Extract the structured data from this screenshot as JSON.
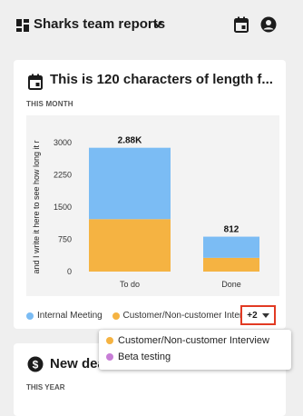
{
  "header": {
    "team_title": "Sharks team reports"
  },
  "card1": {
    "title": "This is 120 characters of length f...",
    "subtitle": "THIS MONTH"
  },
  "chart_data": {
    "type": "bar",
    "stacked": true,
    "categories": [
      "To do",
      "Done"
    ],
    "ylabel": "and I write it here to see how long it r",
    "ylim": [
      0,
      3000
    ],
    "yticks": [
      0,
      750,
      1500,
      2250,
      3000
    ],
    "series": [
      {
        "name": "Customer/Non-customer Interview",
        "color": "#f5b342",
        "values": [
          1220,
          320
        ]
      },
      {
        "name": "Internal Meeting",
        "color": "#7bbcf4",
        "values": [
          1660,
          492
        ]
      }
    ],
    "totals_labels": [
      "2.88K",
      "812"
    ],
    "grid": false
  },
  "legend": {
    "items": [
      {
        "label": "Internal Meeting",
        "color": "#7bbcf4"
      },
      {
        "label": "Customer/Non-customer Interview",
        "color": "#f5b342"
      }
    ],
    "more_label": "+2"
  },
  "popup": {
    "items": [
      {
        "label": "Customer/Non-customer Interview",
        "color": "#f5b342"
      },
      {
        "label": "Beta testing",
        "color": "#c77dd6"
      }
    ]
  },
  "card2": {
    "title": "New dea",
    "subtitle": "THIS YEAR"
  }
}
